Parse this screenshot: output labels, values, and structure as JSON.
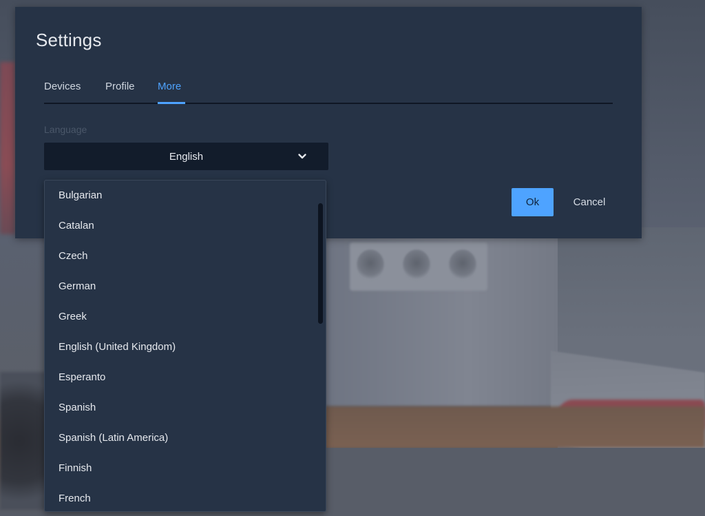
{
  "dialog": {
    "title": "Settings",
    "tabs": [
      {
        "label": "Devices"
      },
      {
        "label": "Profile"
      },
      {
        "label": "More",
        "active": true
      }
    ],
    "language_label": "Language",
    "language_selected": "English",
    "ok_label": "Ok",
    "cancel_label": "Cancel"
  },
  "dropdown": {
    "items": [
      "Bulgarian",
      "Catalan",
      "Czech",
      "German",
      "Greek",
      "English (United Kingdom)",
      "Esperanto",
      "Spanish",
      "Spanish (Latin America)",
      "Finnish",
      "French"
    ]
  },
  "icons": {
    "select_chevron": "chevron-down-icon"
  },
  "colors": {
    "accent": "#4ea3ff",
    "dialog_bg": "#263346",
    "select_bg": "#121c2b"
  }
}
